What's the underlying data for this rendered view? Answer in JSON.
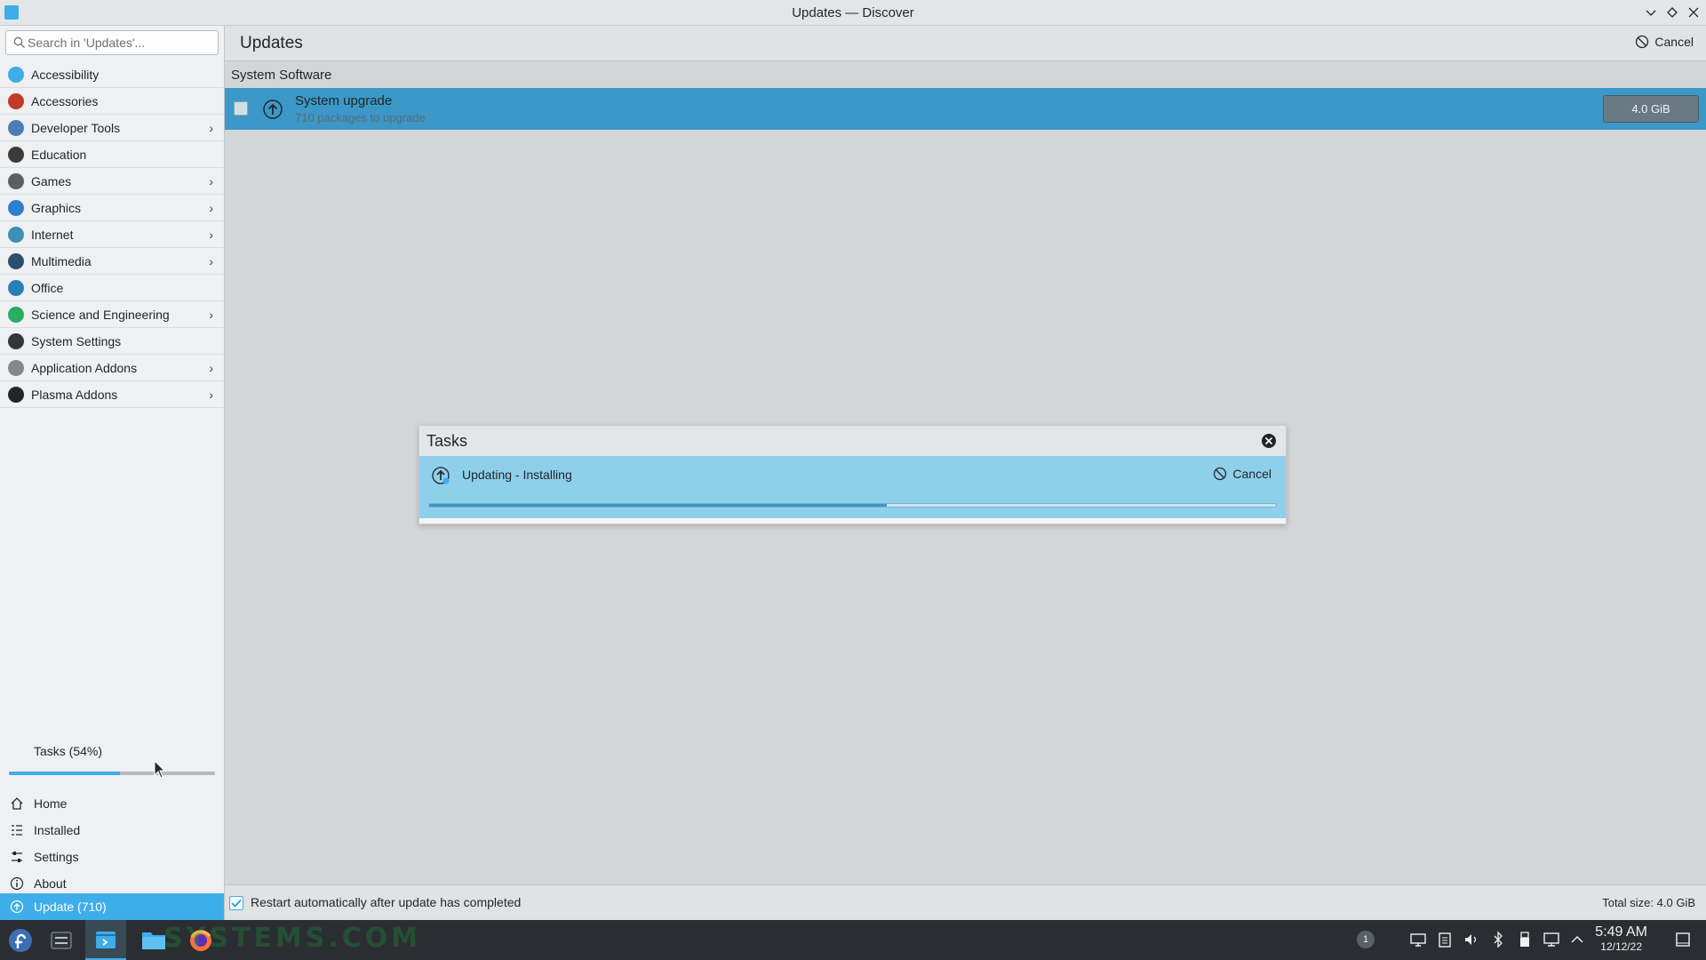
{
  "window": {
    "title": "Updates — Discover",
    "controls": [
      "minimize-icon",
      "maximize-icon",
      "close-icon"
    ]
  },
  "sidebar": {
    "search_placeholder": "Search in 'Updates'...",
    "categories": [
      {
        "label": "Accessibility",
        "icon": "accessibility-icon",
        "color": "#3daee9",
        "has_children": false
      },
      {
        "label": "Accessories",
        "icon": "accessories-icon",
        "color": "#c0392b",
        "has_children": false
      },
      {
        "label": "Developer Tools",
        "icon": "developer-tools-icon",
        "color": "#4a7fb5",
        "has_children": true
      },
      {
        "label": "Education",
        "icon": "education-icon",
        "color": "#3a3a3a",
        "has_children": false
      },
      {
        "label": "Games",
        "icon": "games-icon",
        "color": "#5a5f64",
        "has_children": true
      },
      {
        "label": "Graphics",
        "icon": "graphics-icon",
        "color": "#2f7fd1",
        "has_children": true
      },
      {
        "label": "Internet",
        "icon": "internet-icon",
        "color": "#3c8fb5",
        "has_children": true
      },
      {
        "label": "Multimedia",
        "icon": "multimedia-icon",
        "color": "#2d4f6e",
        "has_children": true
      },
      {
        "label": "Office",
        "icon": "office-icon",
        "color": "#2980b9",
        "has_children": false
      },
      {
        "label": "Science and Engineering",
        "icon": "science-icon",
        "color": "#27ae60",
        "has_children": true
      },
      {
        "label": "System Settings",
        "icon": "system-settings-icon",
        "color": "#31363b",
        "has_children": false
      },
      {
        "label": "Application Addons",
        "icon": "application-addons-icon",
        "color": "#7f8c8d",
        "has_children": true
      },
      {
        "label": "Plasma Addons",
        "icon": "plasma-addons-icon",
        "color": "#232627",
        "has_children": true
      }
    ],
    "tasks_label": "Tasks (54%)",
    "tasks_progress": 0.54,
    "nav": [
      {
        "label": "Home",
        "icon": "home-icon"
      },
      {
        "label": "Installed",
        "icon": "installed-icon"
      },
      {
        "label": "Settings",
        "icon": "settings-icon"
      },
      {
        "label": "About",
        "icon": "about-icon"
      },
      {
        "label": "Update (710)",
        "icon": "update-icon"
      }
    ]
  },
  "main": {
    "page_title": "Updates",
    "cancel_label": "Cancel",
    "section_title": "System Software",
    "upgrade": {
      "title": "System upgrade",
      "subtitle": "710 packages to upgrade",
      "size": "4.0 GiB",
      "checked": false
    },
    "footer": {
      "restart_label": "Restart automatically after update has completed",
      "restart_checked": true,
      "total_size": "Total size: 4.0 GiB"
    }
  },
  "tasks_dialog": {
    "title": "Tasks",
    "task_label": "Updating - Installing",
    "cancel_label": "Cancel",
    "progress": 0.54
  },
  "taskbar": {
    "watermark": "SYSTEMS.COM",
    "notification_count": "1",
    "clock_time": "5:49 AM",
    "clock_date": "12/12/22",
    "colors": {
      "accent": "#3daee9",
      "panel": "#2a2e32"
    }
  }
}
